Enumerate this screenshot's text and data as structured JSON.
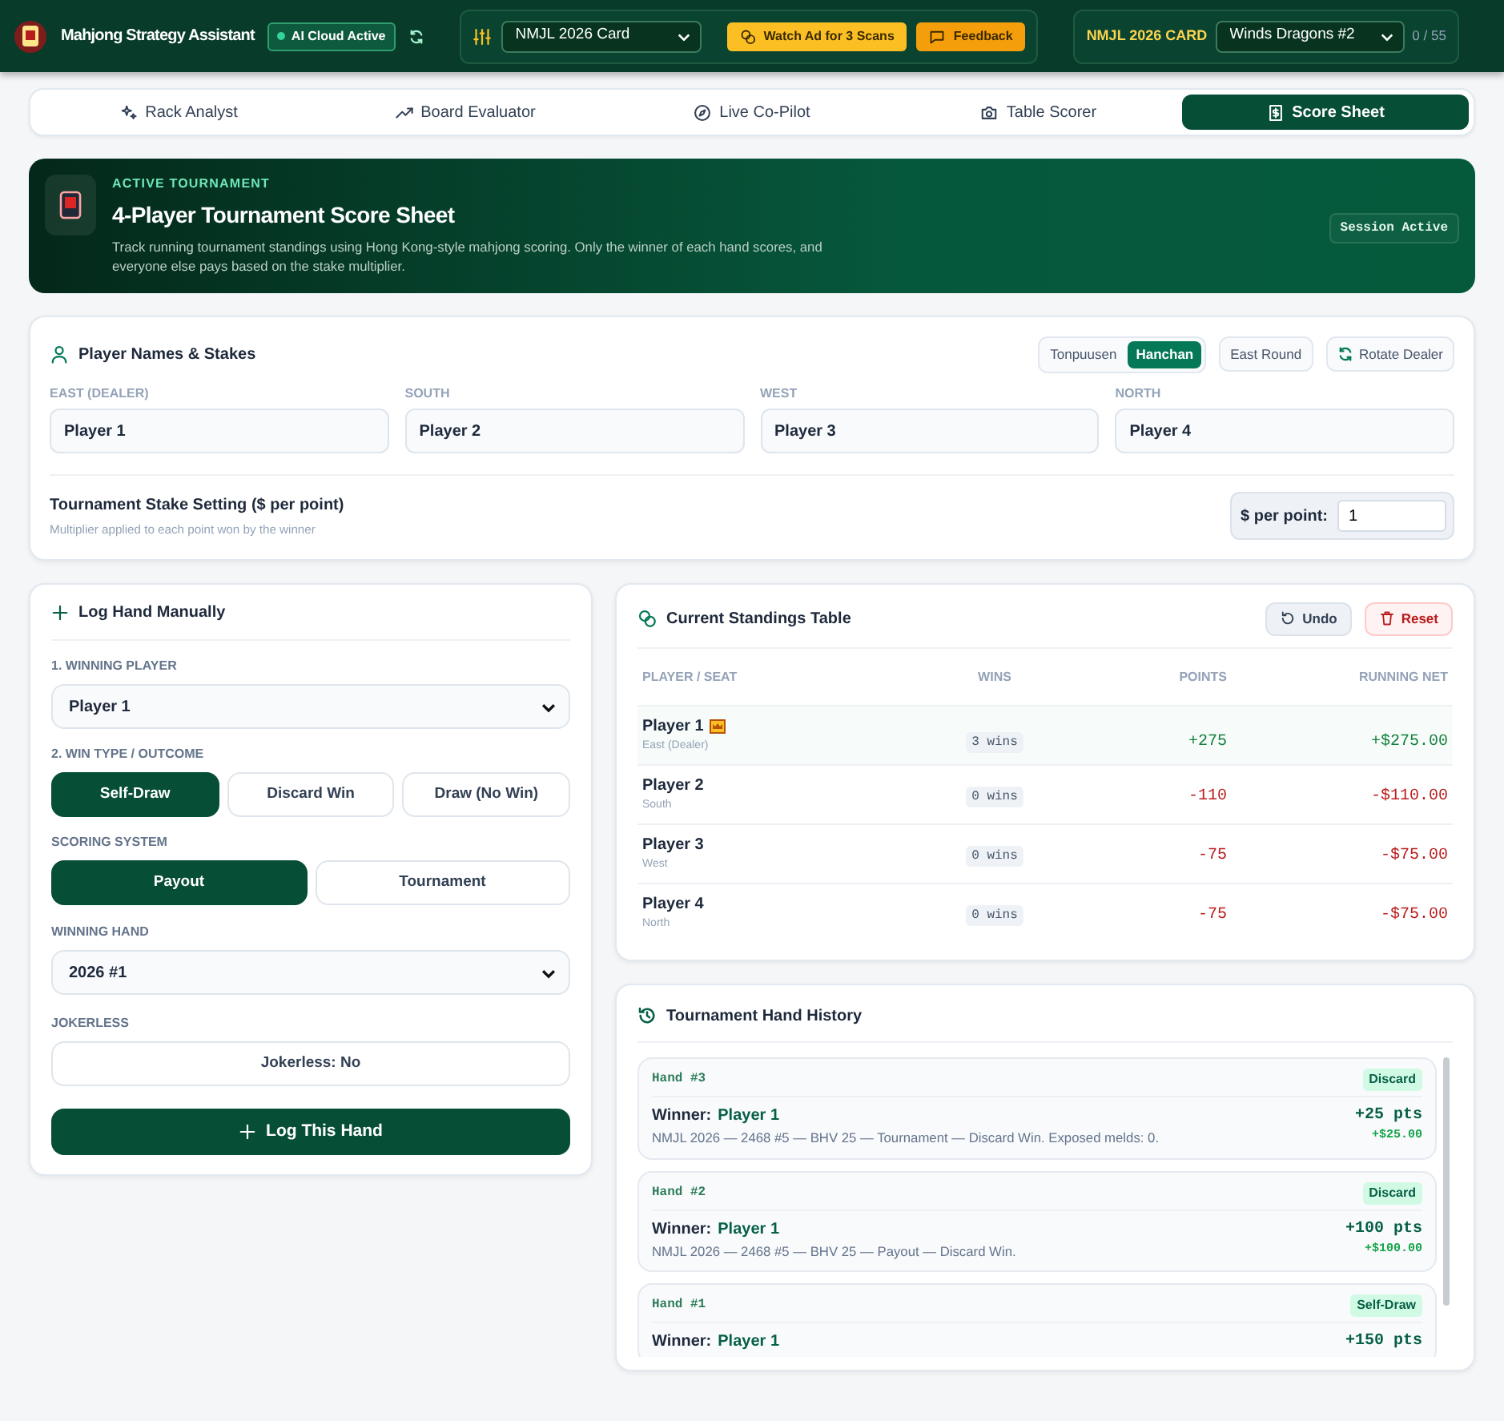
{
  "header": {
    "app_title": "Mahjong Strategy Assistant",
    "cloud_status": "AI Cloud Active",
    "card_select": "NMJL 2026 Card",
    "ad_button": "Watch Ad for 3 Scans",
    "feedback_button": "Feedback",
    "card_label": "NMJL 2026 CARD",
    "hand_select": "Winds Dragons #2",
    "hand_count": "0 / 55"
  },
  "tabs": [
    {
      "label": "Rack Analyst",
      "selected": false
    },
    {
      "label": "Board Evaluator",
      "selected": false
    },
    {
      "label": "Live Co-Pilot",
      "selected": false
    },
    {
      "label": "Table Scorer",
      "selected": false
    },
    {
      "label": "Score Sheet",
      "selected": true
    }
  ],
  "banner": {
    "eyebrow": "ACTIVE TOURNAMENT",
    "title": "4-Player Tournament Score Sheet",
    "description": "Track running tournament standings using Hong Kong-style mahjong scoring. Only the winner of each hand scores, and everyone else pays based on the stake multiplier.",
    "status": "Session Active"
  },
  "players_card": {
    "title": "Player Names & Stakes",
    "modes": [
      {
        "label": "Tonpuusen",
        "selected": false
      },
      {
        "label": "Hanchan",
        "selected": true
      }
    ],
    "round_button": "East Round",
    "rotate_button": "Rotate Dealer",
    "seats": [
      {
        "label": "EAST (DEALER)",
        "value": "Player 1"
      },
      {
        "label": "SOUTH",
        "value": "Player 2"
      },
      {
        "label": "WEST",
        "value": "Player 3"
      },
      {
        "label": "NORTH",
        "value": "Player 4"
      }
    ],
    "stake_title": "Tournament Stake Setting ($ per point)",
    "stake_hint": "Multiplier applied to each point won by the winner",
    "stake_label": "$ per point:",
    "stake_value": "1"
  },
  "log_card": {
    "title": "Log Hand Manually",
    "winner_label": "1. WINNING PLAYER",
    "winner_value": "Player 1",
    "outcome_label": "2. WIN TYPE / OUTCOME",
    "outcomes": [
      {
        "label": "Self-Draw",
        "selected": true
      },
      {
        "label": "Discard Win",
        "selected": false
      },
      {
        "label": "Draw (No Win)",
        "selected": false
      }
    ],
    "scoring_label": "SCORING SYSTEM",
    "scoring": [
      {
        "label": "Payout",
        "selected": true
      },
      {
        "label": "Tournament",
        "selected": false
      }
    ],
    "hand_label": "WINNING HAND",
    "hand_value": "2026 #1",
    "jokerless_label": "JOKERLESS",
    "jokerless_button": "Jokerless: No",
    "submit_button": "Log This Hand"
  },
  "standings": {
    "title": "Current Standings Table",
    "undo_button": "Undo",
    "reset_button": "Reset",
    "columns": [
      "PLAYER / SEAT",
      "WINS",
      "POINTS",
      "RUNNING NET"
    ],
    "rows": [
      {
        "name": "Player 1",
        "seat": "East (Dealer)",
        "leader": true,
        "wins": "3 wins",
        "points": "+275",
        "net": "+$275.00",
        "positive": true
      },
      {
        "name": "Player 2",
        "seat": "South",
        "leader": false,
        "wins": "0 wins",
        "points": "-110",
        "net": "-$110.00",
        "positive": false
      },
      {
        "name": "Player 3",
        "seat": "West",
        "leader": false,
        "wins": "0 wins",
        "points": "-75",
        "net": "-$75.00",
        "positive": false
      },
      {
        "name": "Player 4",
        "seat": "North",
        "leader": false,
        "wins": "0 wins",
        "points": "-75",
        "net": "-$75.00",
        "positive": false
      }
    ]
  },
  "history": {
    "title": "Tournament Hand History",
    "entries": [
      {
        "hand": "Hand #3",
        "type": "Discard",
        "winner_label": "Winner:",
        "winner": "Player 1",
        "detail": "NMJL 2026 — 2468 #5 — BHV 25 — Tournament — Discard Win. Exposed melds: 0.",
        "points": "+25 pts",
        "money": "+$25.00"
      },
      {
        "hand": "Hand #2",
        "type": "Discard",
        "winner_label": "Winner:",
        "winner": "Player 1",
        "detail": "NMJL 2026 — 2468 #5 — BHV 25 — Payout — Discard Win.",
        "points": "+100 pts",
        "money": "+$100.00"
      },
      {
        "hand": "Hand #1",
        "type": "Self-Draw",
        "winner_label": "Winner:",
        "winner": "Player 1",
        "points": "+150 pts"
      }
    ]
  }
}
